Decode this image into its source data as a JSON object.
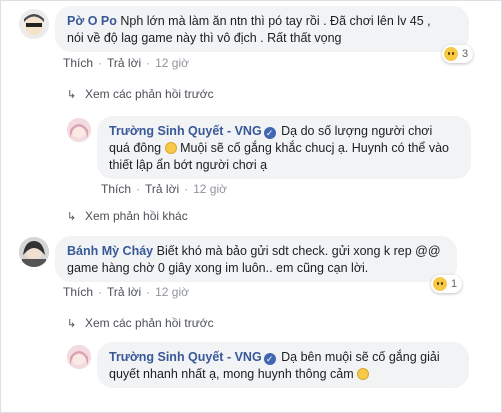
{
  "comments": [
    {
      "author": "Pờ O Po",
      "text_line1": "Nph lớn mà làm ăn ntn thì pó tay rồi . Đã chơi lên lv 45 ,",
      "text_line2": "nói về độ lag game này thì vô địch . Rất thất vọng",
      "like_label": "Thích",
      "reply_label": "Trả lời",
      "time": "12 giờ",
      "reaction_count": "3",
      "reaction_icon": "sad-icon"
    },
    {
      "author": "Bánh Mỳ Cháy",
      "text_line1": "Biết khó mà bảo gửi sdt check. gửi xong k rep @@",
      "text_line2": "game hàng chờ 0 giây xong im luôn.. em cũng cạn lời.",
      "like_label": "Thích",
      "reply_label": "Trả lời",
      "time": "12 giờ",
      "reaction_count": "1",
      "reaction_icon": "sad-icon"
    }
  ],
  "previous_replies_label": "Xem các phản hồi trước",
  "other_replies_label": "Xem phản hồi khác",
  "replies": [
    {
      "author": "Trường Sinh Quyết - VNG",
      "text_line1_prefix": "Dạ do số lượng người chơi",
      "text_line2": "quá đông",
      "text_line2_suffix": " Muội sẽ cố gắng khắc chucj ạ. Huynh có thể vào",
      "text_line3": "thiết lập ẩn bớt người chơi ạ",
      "like_label": "Thích",
      "reply_label": "Trả lời",
      "time": "12 giờ"
    },
    {
      "author": "Trường Sinh Quyết - VNG",
      "text_line1_prefix": "Dạ bên muội sẽ cố gắng giải",
      "text_line2": "quyết nhanh nhất ạ, mong huynh thông cảm"
    }
  ],
  "verified_icon": "check-badge-icon",
  "colors": {
    "author": "#385898",
    "bubble": "#f2f3f5",
    "verified": "#4267b2"
  }
}
